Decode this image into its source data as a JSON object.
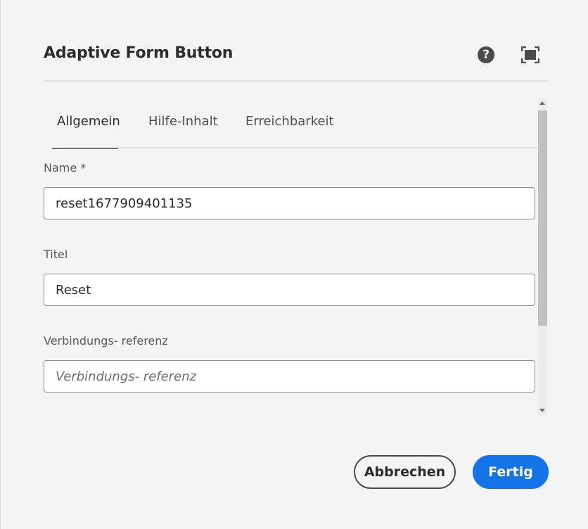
{
  "dialog": {
    "title": "Adaptive Form Button",
    "help_icon": "help-icon",
    "fullscreen_icon": "fullscreen-icon"
  },
  "tabs": [
    {
      "label": "Allgemein",
      "active": true
    },
    {
      "label": "Hilfe-Inhalt",
      "active": false
    },
    {
      "label": "Erreichbarkeit",
      "active": false
    }
  ],
  "fields": {
    "name": {
      "label": "Name *",
      "value": "reset1677909401135"
    },
    "title": {
      "label": "Titel",
      "value": "Reset"
    },
    "bind_ref": {
      "label": "Verbindungs- referenz",
      "value": "",
      "placeholder": "Verbindungs- referenz"
    }
  },
  "buttons": {
    "cancel": "Abbrechen",
    "done": "Fertig"
  },
  "colors": {
    "accent": "#1473e6",
    "background": "#f4f4f4"
  }
}
